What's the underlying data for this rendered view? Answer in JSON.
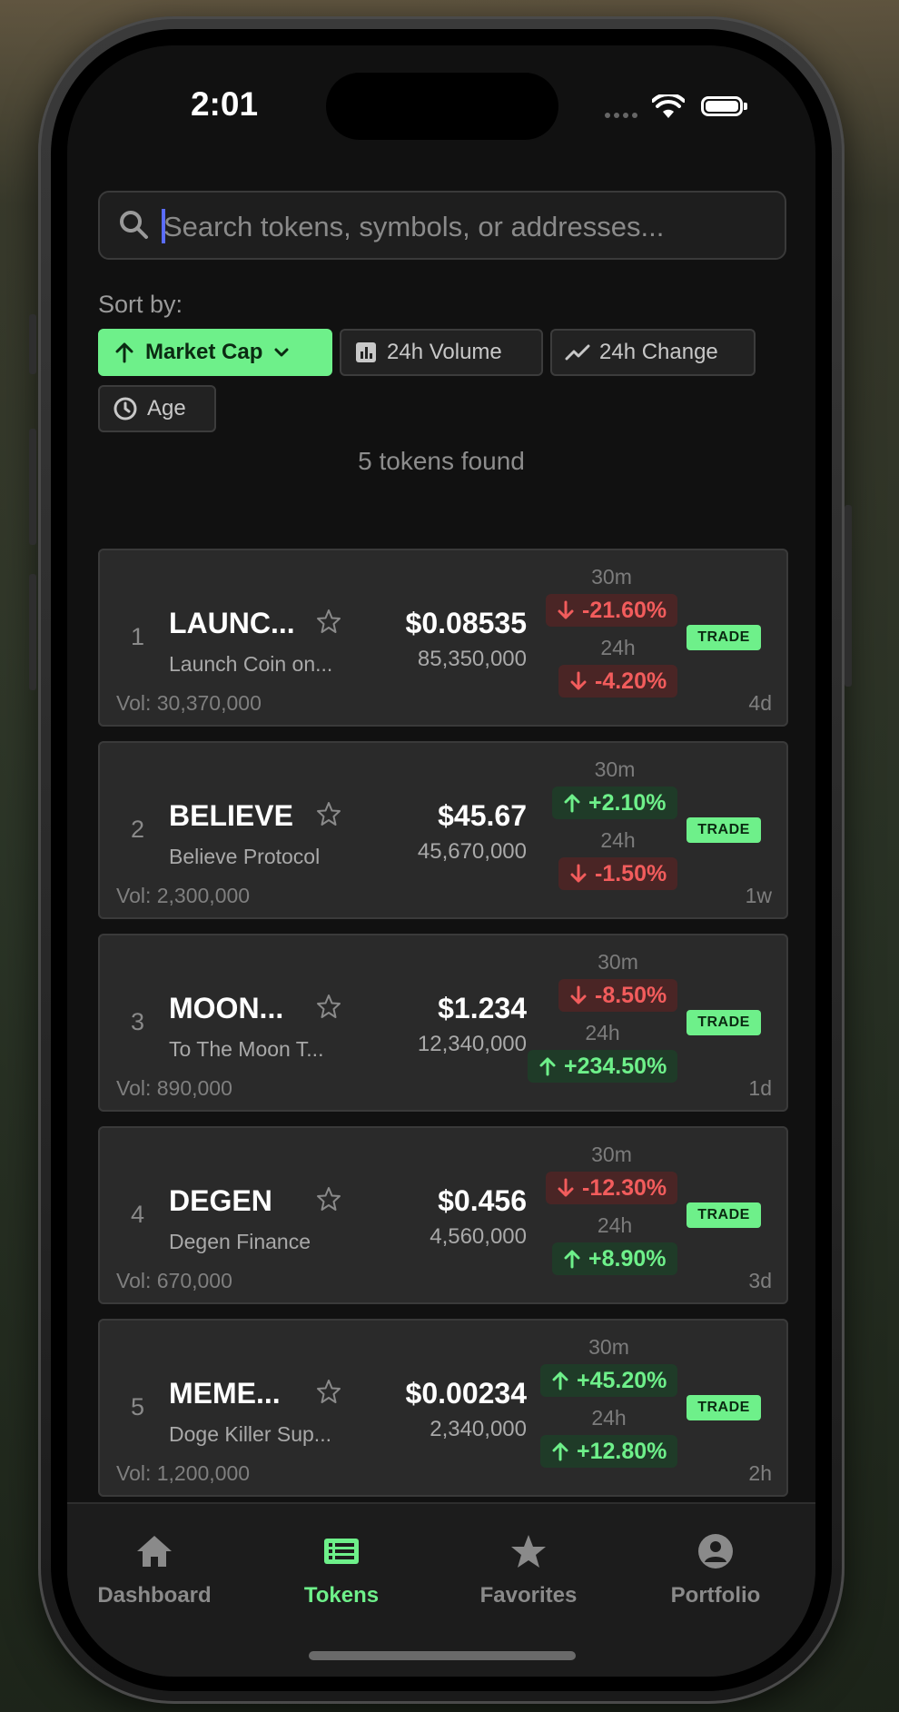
{
  "status_bar": {
    "time": "2:01"
  },
  "search": {
    "placeholder": "Search tokens, symbols, or addresses..."
  },
  "sort": {
    "label": "Sort by:",
    "options": [
      {
        "label": "Market Cap",
        "icon": "arrow-up-icon",
        "active": true
      },
      {
        "label": "24h Volume",
        "icon": "bar-chart-icon",
        "active": false
      },
      {
        "label": "24h Change",
        "icon": "trend-line-icon",
        "active": false
      },
      {
        "label": "Age",
        "icon": "clock-icon",
        "active": false
      }
    ]
  },
  "results_count": "5 tokens found",
  "labels": {
    "m30": "30m",
    "h24": "24h",
    "trade": "TRADE"
  },
  "tokens": [
    {
      "rank": "1",
      "symbol": "LAUNC...",
      "name": "Launch Coin on...",
      "price": "$0.08535",
      "mcap": "85,350,000",
      "volume": "Vol: 30,370,000",
      "age": "4d",
      "change_30m": "-21.60%",
      "change_24h": "-4.20%"
    },
    {
      "rank": "2",
      "symbol": "BELIEVE",
      "name": "Believe Protocol",
      "price": "$45.67",
      "mcap": "45,670,000",
      "volume": "Vol: 2,300,000",
      "age": "1w",
      "change_30m": "+2.10%",
      "change_24h": "-1.50%"
    },
    {
      "rank": "3",
      "symbol": "MOON...",
      "name": "To The Moon T...",
      "price": "$1.234",
      "mcap": "12,340,000",
      "volume": "Vol: 890,000",
      "age": "1d",
      "change_30m": "-8.50%",
      "change_24h": "+234.50%"
    },
    {
      "rank": "4",
      "symbol": "DEGEN",
      "name": "Degen Finance",
      "price": "$0.456",
      "mcap": "4,560,000",
      "volume": "Vol: 670,000",
      "age": "3d",
      "change_30m": "-12.30%",
      "change_24h": "+8.90%"
    },
    {
      "rank": "5",
      "symbol": "MEME...",
      "name": "Doge Killer Sup...",
      "price": "$0.00234",
      "mcap": "2,340,000",
      "volume": "Vol: 1,200,000",
      "age": "2h",
      "change_30m": "+45.20%",
      "change_24h": "+12.80%"
    }
  ],
  "tabs": [
    {
      "label": "Dashboard",
      "icon": "home-icon",
      "active": false
    },
    {
      "label": "Tokens",
      "icon": "list-icon",
      "active": true
    },
    {
      "label": "Favorites",
      "icon": "star-icon",
      "active": false
    },
    {
      "label": "Portfolio",
      "icon": "user-circle-icon",
      "active": false
    }
  ],
  "colors": {
    "accent": "#6ef08a",
    "negative": "#f25c5c",
    "background": "#111111",
    "card": "#2a2a2a"
  }
}
